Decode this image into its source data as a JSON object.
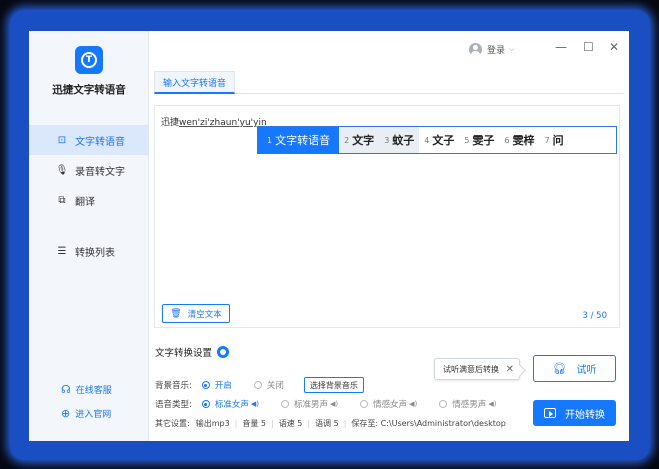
{
  "app": {
    "title": "迅捷文字转语音"
  },
  "sidebar": {
    "items": [
      {
        "label": "文字转语音",
        "icon": "text-icon",
        "active": true
      },
      {
        "label": "录音转文字",
        "icon": "microphone-icon",
        "active": false
      },
      {
        "label": "翻译",
        "icon": "translate-icon",
        "active": false
      },
      {
        "label": "转换列表",
        "icon": "list-icon",
        "active": false
      }
    ],
    "links": [
      {
        "label": "在线客服",
        "icon": "headset-icon"
      },
      {
        "label": "进入官网",
        "icon": "globe-icon"
      }
    ]
  },
  "header": {
    "login_label": "登录"
  },
  "tabs": [
    {
      "label": "输入文字转语音"
    }
  ],
  "editor": {
    "typed_prefix": "迅捷",
    "typed_pinyin": "wen'zi'zhaun'yu'yin",
    "char_count": "3 / 50",
    "clear_label": "清空文本"
  },
  "ime": {
    "candidates": [
      {
        "num": "1",
        "text": "文字转语音"
      },
      {
        "num": "2",
        "text": "文字"
      },
      {
        "num": "3",
        "text": "蚊子"
      },
      {
        "num": "4",
        "text": "文子"
      },
      {
        "num": "5",
        "text": "雯子"
      },
      {
        "num": "6",
        "text": "雯梓"
      },
      {
        "num": "7",
        "text": "问"
      }
    ]
  },
  "settings": {
    "title": "文字转换设置",
    "bgm_label": "背景音乐:",
    "bgm_on": "开启",
    "bgm_off": "关闭",
    "bgm_button": "选择背景音乐",
    "voice_label": "语音类型:",
    "voices": [
      "标准女声",
      "标准男声",
      "情感女声",
      "情感男声"
    ],
    "other_label": "其它设置:",
    "output": "输出mp3",
    "volume": "音量 5",
    "speed": "语速 5",
    "tone": "语调 5",
    "save_path": "保存至: C:\\Users\\Administrator\\desktop"
  },
  "tooltip": {
    "text": "试听满意后转换"
  },
  "buttons": {
    "listen": "试听",
    "start": "开始转换"
  },
  "colors": {
    "accent": "#1677ff",
    "frame": "#1a4fc4"
  }
}
